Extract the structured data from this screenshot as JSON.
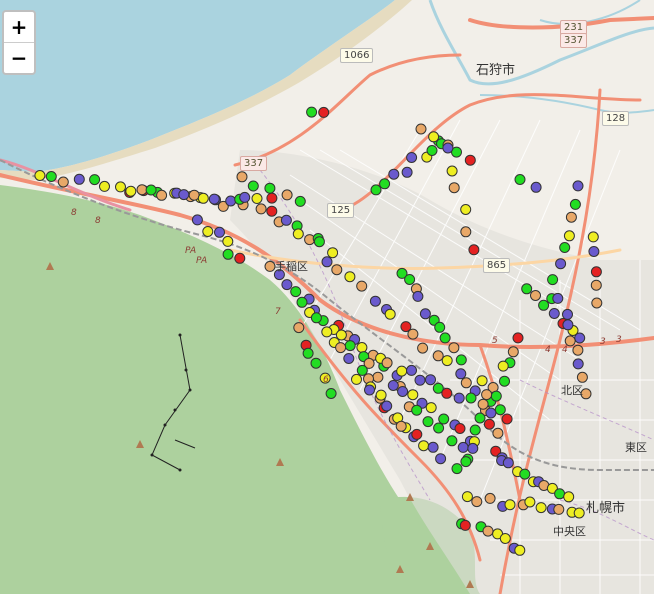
{
  "map": {
    "zoom_in_label": "+",
    "zoom_out_label": "−",
    "place_labels": {
      "ishikari": "石狩市",
      "teine": "手稲区",
      "kita": "北区",
      "higashi": "東区",
      "sapporo": "札幌市",
      "chuo": "中央区"
    },
    "shields": {
      "r231": "231",
      "r337": "337",
      "r1066": "1066",
      "r128": "128",
      "r125": "125",
      "r865": "865",
      "r337b": "337"
    },
    "route_numbers": {
      "n8a": "8",
      "n8b": "8",
      "pa1": "PA",
      "pa2": "PA",
      "n7": "7",
      "n6": "6",
      "n5": "5",
      "n4a": "4",
      "n4b": "4",
      "n3a": "3",
      "n3b": "3"
    },
    "colors": {
      "sea": "#aad3df",
      "forest": "#add19e",
      "land": "#f2efe9",
      "road_major": "#f28f75",
      "road_minor": "#ffffff",
      "river": "#aad3df"
    },
    "marker_colors": {
      "green": "#22dd22",
      "yellow": "#eeee22",
      "orange": "#e8a868",
      "purple": "#6a5acd",
      "red": "#e42222"
    }
  }
}
